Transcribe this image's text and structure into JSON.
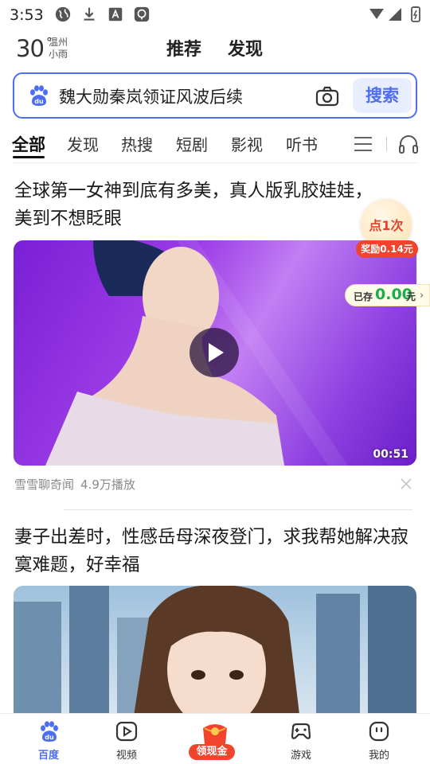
{
  "status_bar": {
    "time": "3:53"
  },
  "header": {
    "weather": {
      "temperature": "30",
      "degree": "°",
      "city": "温州",
      "condition": "小雨"
    },
    "tabs": [
      "推荐",
      "发现"
    ]
  },
  "search": {
    "query": "魏大勋秦岚领证风波后续",
    "button_label": "搜索"
  },
  "categories": [
    "全部",
    "发现",
    "热搜",
    "短剧",
    "影视",
    "听书"
  ],
  "feed": [
    {
      "title": "全球第一女神到底有多美，真人版乳胶娃娃，美到不想眨眼",
      "duration": "00:51",
      "source": "雪雪聊奇闻",
      "plays": "4.9万播放"
    },
    {
      "title": "妻子出差时，性感岳母深夜登门，求我帮她解决寂寞难题，好幸福"
    }
  ],
  "reward": {
    "click_label": "点1次",
    "reward_label": "奖励0.14元",
    "saved_label": "已存",
    "saved_amount": "0.00",
    "saved_unit": "元"
  },
  "bottom_nav": {
    "items": [
      "百度",
      "视频",
      "领现金",
      "游戏",
      "我的"
    ]
  },
  "colors": {
    "accent": "#4e6ef2",
    "reward_red": "#f2432d",
    "money_green": "#1aad4b"
  }
}
